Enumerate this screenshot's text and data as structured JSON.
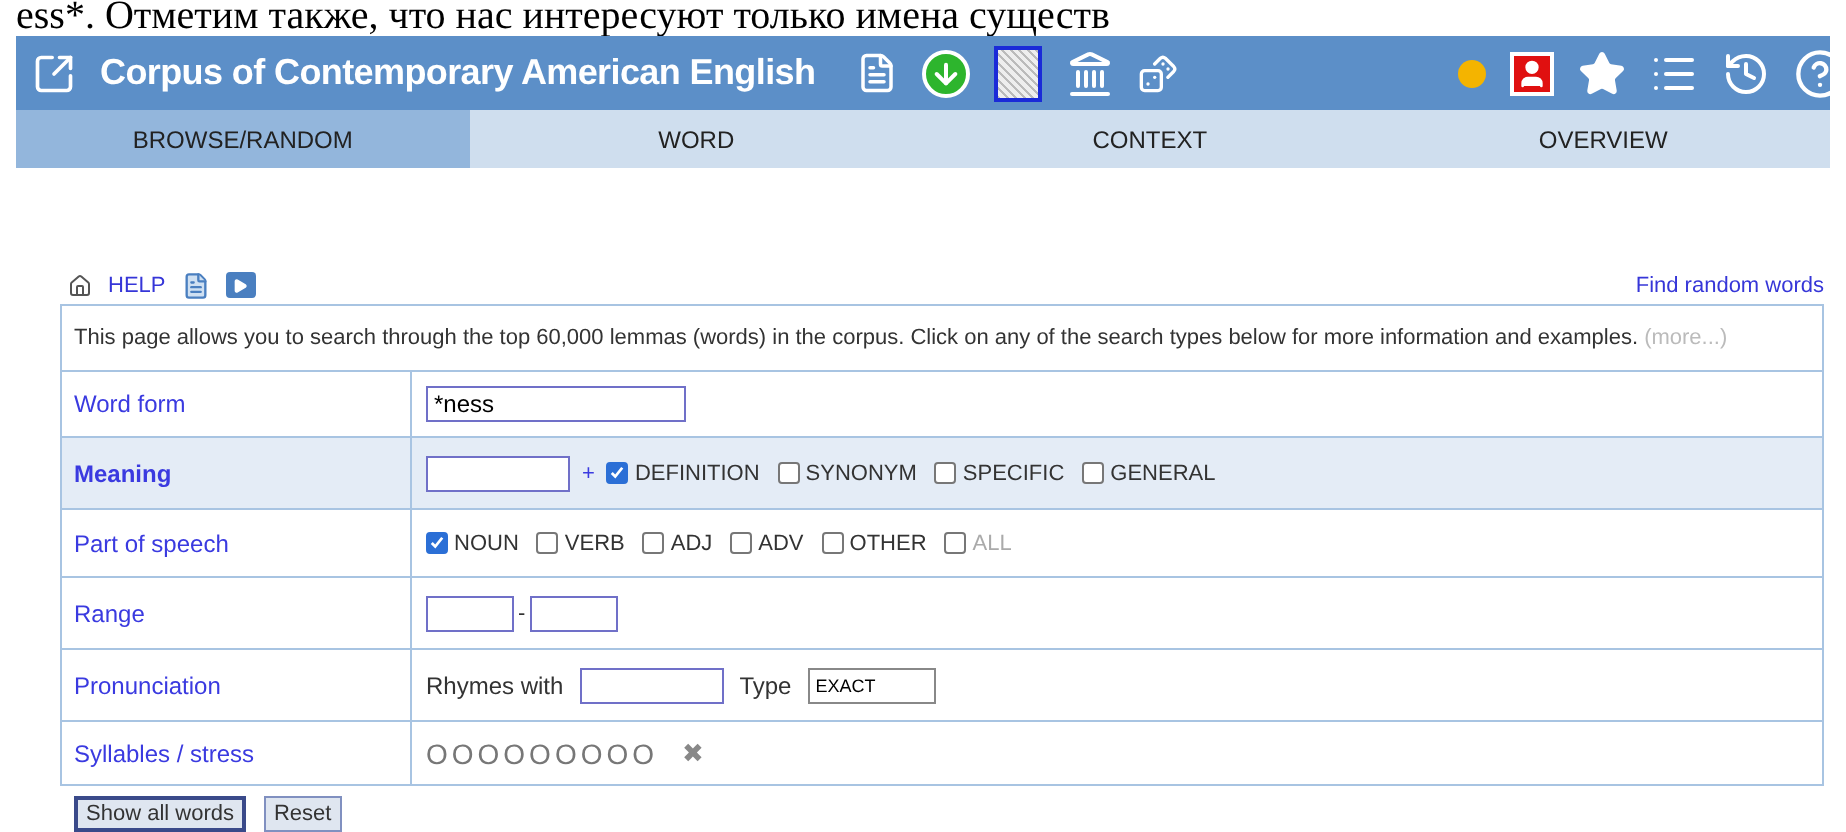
{
  "header_text": "ess*. Отметим также, что нас интересуют только имена существ",
  "banner": {
    "title": "Corpus of Contemporary American English"
  },
  "tabs": [
    {
      "label": "BROWSE/RANDOM",
      "selected": true
    },
    {
      "label": "WORD",
      "selected": false
    },
    {
      "label": "CONTEXT",
      "selected": false
    },
    {
      "label": "OVERVIEW",
      "selected": false
    }
  ],
  "help_bar": {
    "help": "HELP",
    "random_link": "Find random words"
  },
  "form": {
    "intro": "This page allows you to search through the top 60,000 lemmas (words) in the corpus. Click on any of the search types below for more information and examples.",
    "more": "(more...)",
    "rows": [
      {
        "kind": "text",
        "label": "Word form",
        "highlighted": false,
        "value": "*ness"
      },
      {
        "kind": "meaning",
        "label": "Meaning",
        "highlighted": true,
        "plus": "+",
        "options": [
          {
            "label": "DEFINITION",
            "checked": true,
            "disabled": false
          },
          {
            "label": "SYNONYM",
            "checked": false,
            "disabled": false
          },
          {
            "label": "SPECIFIC",
            "checked": false,
            "disabled": false
          },
          {
            "label": "GENERAL",
            "checked": false,
            "disabled": false
          }
        ]
      },
      {
        "kind": "checks",
        "label": "Part of speech",
        "highlighted": false,
        "options": [
          {
            "label": "NOUN",
            "checked": true,
            "disabled": false
          },
          {
            "label": "VERB",
            "checked": false,
            "disabled": false
          },
          {
            "label": "ADJ",
            "checked": false,
            "disabled": false
          },
          {
            "label": "ADV",
            "checked": false,
            "disabled": false
          },
          {
            "label": "OTHER",
            "checked": false,
            "disabled": false
          },
          {
            "label": "ALL",
            "checked": false,
            "disabled": true
          }
        ]
      },
      {
        "kind": "range",
        "label": "Range",
        "highlighted": false,
        "separator": "-"
      },
      {
        "kind": "pronunciation",
        "label": "Pronunciation",
        "highlighted": false,
        "rhymes_label": "Rhymes with",
        "type_label": "Type",
        "type_value": "EXACT"
      },
      {
        "kind": "syllables",
        "label": "Syllables / stress",
        "highlighted": false,
        "marks": "OOOOOOOOO",
        "clear": "✖"
      }
    ]
  },
  "buttons": [
    {
      "label": "Show all words",
      "selected": true
    },
    {
      "label": "Reset",
      "selected": false
    }
  ]
}
